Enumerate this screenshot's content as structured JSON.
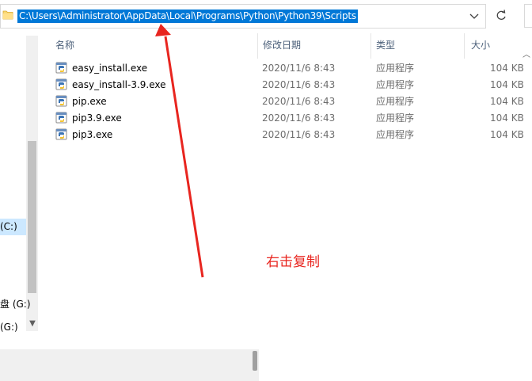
{
  "address_bar": {
    "path": "C:\\Users\\Administrator\\AppData\\Local\\Programs\\Python\\Python39\\Scripts"
  },
  "columns": {
    "name": "名称",
    "modified": "修改日期",
    "type": "类型",
    "size": "大小"
  },
  "files": [
    {
      "name": "easy_install.exe",
      "modified": "2020/11/6 8:43",
      "type": "应用程序",
      "size": "104 KB"
    },
    {
      "name": "easy_install-3.9.exe",
      "modified": "2020/11/6 8:43",
      "type": "应用程序",
      "size": "104 KB"
    },
    {
      "name": "pip.exe",
      "modified": "2020/11/6 8:43",
      "type": "应用程序",
      "size": "104 KB"
    },
    {
      "name": "pip3.9.exe",
      "modified": "2020/11/6 8:43",
      "type": "应用程序",
      "size": "104 KB"
    },
    {
      "name": "pip3.exe",
      "modified": "2020/11/6 8:43",
      "type": "应用程序",
      "size": "104 KB"
    }
  ],
  "nav": {
    "drive_c": "(C:)",
    "drive_g1": "盘 (G:)",
    "drive_g2": "(G:)"
  },
  "annotation": {
    "text": "右击复制",
    "color": "#e8251f"
  },
  "colors": {
    "selection": "#0078d7",
    "nav_selected": "#cce8ff",
    "arrow": "#e8251f"
  },
  "icons": {
    "folder": "folder-icon",
    "dropdown": "chevron-down-icon",
    "refresh": "refresh-icon",
    "file": "python-exe-icon"
  }
}
